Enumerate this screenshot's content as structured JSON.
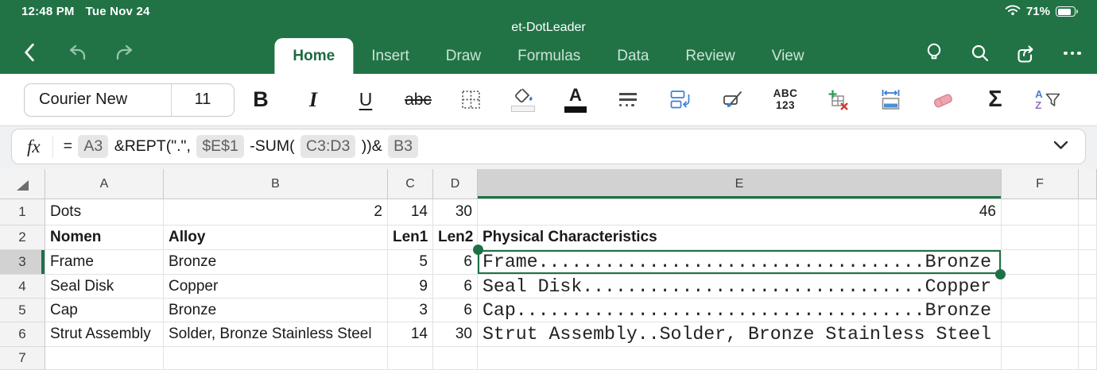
{
  "status_bar": {
    "time": "12:48 PM",
    "date": "Tue Nov 24",
    "battery_percent": "71%",
    "battery_level": 0.71
  },
  "title_bar": {
    "document_title": "et-DotLeader",
    "tabs": [
      {
        "label": "Home",
        "active": true
      },
      {
        "label": "Insert",
        "active": false
      },
      {
        "label": "Draw",
        "active": false
      },
      {
        "label": "Formulas",
        "active": false
      },
      {
        "label": "Data",
        "active": false
      },
      {
        "label": "Review",
        "active": false
      },
      {
        "label": "View",
        "active": false
      }
    ]
  },
  "toolbar": {
    "font_name": "Courier New",
    "font_size": "11",
    "bold_label": "B",
    "italic_label": "I",
    "underline_label": "U",
    "strikethrough_label": "abc",
    "number_format_line1": "ABC",
    "number_format_line2": "123",
    "autosum_label": "Σ",
    "sort_a_label": "A",
    "sort_z_label": "Z"
  },
  "formula_bar": {
    "fx_label": "fx",
    "formula_full": "= A3 &REPT(\".\", $E$1 -SUM( C3:D3 ))& B3",
    "tokens": [
      {
        "text": "= ",
        "ref": false
      },
      {
        "text": "A3",
        "ref": true
      },
      {
        "text": " &REPT(\".\", ",
        "ref": false
      },
      {
        "text": "$E$1",
        "ref": true
      },
      {
        "text": " -SUM( ",
        "ref": false
      },
      {
        "text": "C3:D3",
        "ref": true
      },
      {
        "text": " ))& ",
        "ref": false
      },
      {
        "text": "B3",
        "ref": true
      }
    ]
  },
  "grid": {
    "columns": [
      "A",
      "B",
      "C",
      "D",
      "E",
      "F",
      ""
    ],
    "selected_column": "E",
    "selected_row": "3",
    "selected_cell": "E3",
    "dot_leader_total": 46,
    "rows": [
      {
        "num": "1",
        "cells": {
          "A": "Dots",
          "B": "2",
          "C": "14",
          "D": "30",
          "E": "46",
          "F": ""
        }
      },
      {
        "num": "2",
        "bold": true,
        "cells": {
          "A": "Nomen",
          "B": "Alloy",
          "C": "Len1",
          "D": "Len2",
          "E": "Physical Characteristics",
          "F": ""
        }
      },
      {
        "num": "3",
        "dot_leader": true,
        "cells": {
          "A": "Frame",
          "B": "Bronze",
          "C": "5",
          "D": "6",
          "F": ""
        }
      },
      {
        "num": "4",
        "dot_leader": true,
        "cells": {
          "A": "Seal Disk",
          "B": "Copper",
          "C": "9",
          "D": "6",
          "F": ""
        }
      },
      {
        "num": "5",
        "dot_leader": true,
        "cells": {
          "A": "Cap",
          "B": "Bronze",
          "C": "3",
          "D": "6",
          "F": ""
        }
      },
      {
        "num": "6",
        "dot_leader": true,
        "cells": {
          "A": "Strut Assembly",
          "B": "Solder, Bronze Stainless Steel",
          "C": "14",
          "D": "30",
          "F": ""
        }
      },
      {
        "num": "7",
        "cells": {
          "A": "",
          "B": "",
          "C": "",
          "D": "",
          "E": "",
          "F": ""
        }
      }
    ]
  },
  "colors": {
    "brand_green": "#217346",
    "accent_green": "#1e7145",
    "selection_gray": "#d2d2d2",
    "ref_pill_bg": "#e6e6e6",
    "blue": "#3f7fd6",
    "red": "#cf3a2e",
    "purple": "#8f6fc9"
  }
}
